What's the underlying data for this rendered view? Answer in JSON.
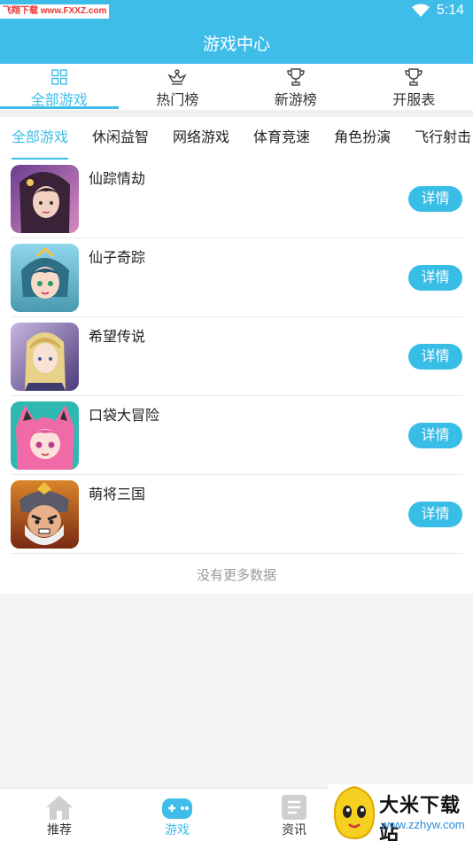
{
  "status": {
    "watermark": "飞翔下载 www.FXXZ.com",
    "time": "5:14"
  },
  "header": {
    "title": "游戏中心"
  },
  "main_tabs": [
    {
      "label": "全部游戏",
      "icon": "grid-icon",
      "active": true
    },
    {
      "label": "热门榜",
      "icon": "crown-icon",
      "active": false
    },
    {
      "label": "新游榜",
      "icon": "trophy-icon",
      "active": false
    },
    {
      "label": "开服表",
      "icon": "trophy-icon",
      "active": false
    }
  ],
  "category_tabs": [
    {
      "label": "全部游戏",
      "active": true
    },
    {
      "label": "休闲益智"
    },
    {
      "label": "网络游戏"
    },
    {
      "label": "体育竞速"
    },
    {
      "label": "角色扮演"
    },
    {
      "label": "飞行射击"
    }
  ],
  "games": [
    {
      "name": "仙踪情劫",
      "button": "详情"
    },
    {
      "name": "仙子奇踪",
      "button": "详情"
    },
    {
      "name": "希望传说",
      "button": "详情"
    },
    {
      "name": "口袋大冒险",
      "button": "详情"
    },
    {
      "name": "萌将三国",
      "button": "详情"
    }
  ],
  "list_footer": "没有更多数据",
  "bottom_nav": [
    {
      "label": "推荐",
      "icon": "home-icon",
      "active": false
    },
    {
      "label": "游戏",
      "icon": "gamepad-icon",
      "active": true
    },
    {
      "label": "资讯",
      "icon": "news-icon",
      "active": false
    }
  ],
  "site_badge": {
    "name": "大米下载站",
    "url": "www.zzhyw.com"
  },
  "colors": {
    "accent": "#3fbde9",
    "button": "#38bde6"
  }
}
